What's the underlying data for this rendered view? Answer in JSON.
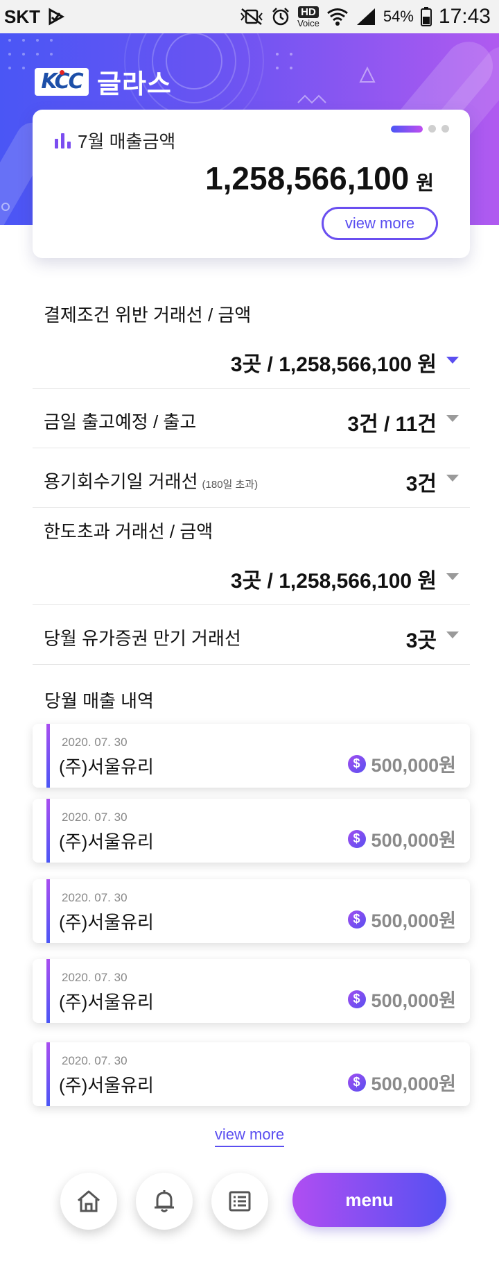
{
  "status_bar": {
    "carrier": "SKT",
    "hd_label": "HD",
    "voice_label": "Voice",
    "battery": "54%",
    "time": "17:43"
  },
  "header": {
    "logo_text": "KCC",
    "brand_name": "글라스"
  },
  "summary": {
    "label": "7월 매출금액",
    "amount": "1,258,566,100",
    "unit": "원",
    "view_more": "view more",
    "pager": {
      "total": 3,
      "active": 1
    }
  },
  "info_rows": [
    {
      "title": "결제조건 위반 거래선 / 금액",
      "sub": "",
      "value": "3곳 / 1,258,566,100 원"
    },
    {
      "title": "금일 출고예정 / 출고",
      "sub": "",
      "value": "3건 / 11건"
    },
    {
      "title": "용기회수기일 거래선",
      "sub": "(180일 초과)",
      "value": "3건"
    },
    {
      "title": "한도초과 거래선 / 금액",
      "sub": "",
      "value": "3곳 / 1,258,566,100 원"
    },
    {
      "title": "당월 유가증권 만기 거래선",
      "sub": "",
      "value": "3곳"
    }
  ],
  "sales": {
    "title": "당월 매출 내역",
    "items": [
      {
        "date": "2020. 07. 30",
        "company": "(주)서울유리",
        "amount": "500,000원"
      },
      {
        "date": "2020. 07. 30",
        "company": "(주)서울유리",
        "amount": "500,000원"
      },
      {
        "date": "2020. 07. 30",
        "company": "(주)서울유리",
        "amount": "500,000원"
      },
      {
        "date": "2020. 07. 30",
        "company": "(주)서울유리",
        "amount": "500,000원"
      },
      {
        "date": "2020. 07. 30",
        "company": "(주)서울유리",
        "amount": "500,000원"
      }
    ],
    "view_more": "view more"
  },
  "bottom_nav": {
    "home_icon": "home-icon",
    "bell_icon": "bell-icon",
    "list_icon": "list-icon",
    "menu_label": "menu"
  },
  "colors": {
    "accent": "#5a4ef0",
    "gradient_start": "#4a56f5",
    "gradient_end": "#b05af0"
  }
}
